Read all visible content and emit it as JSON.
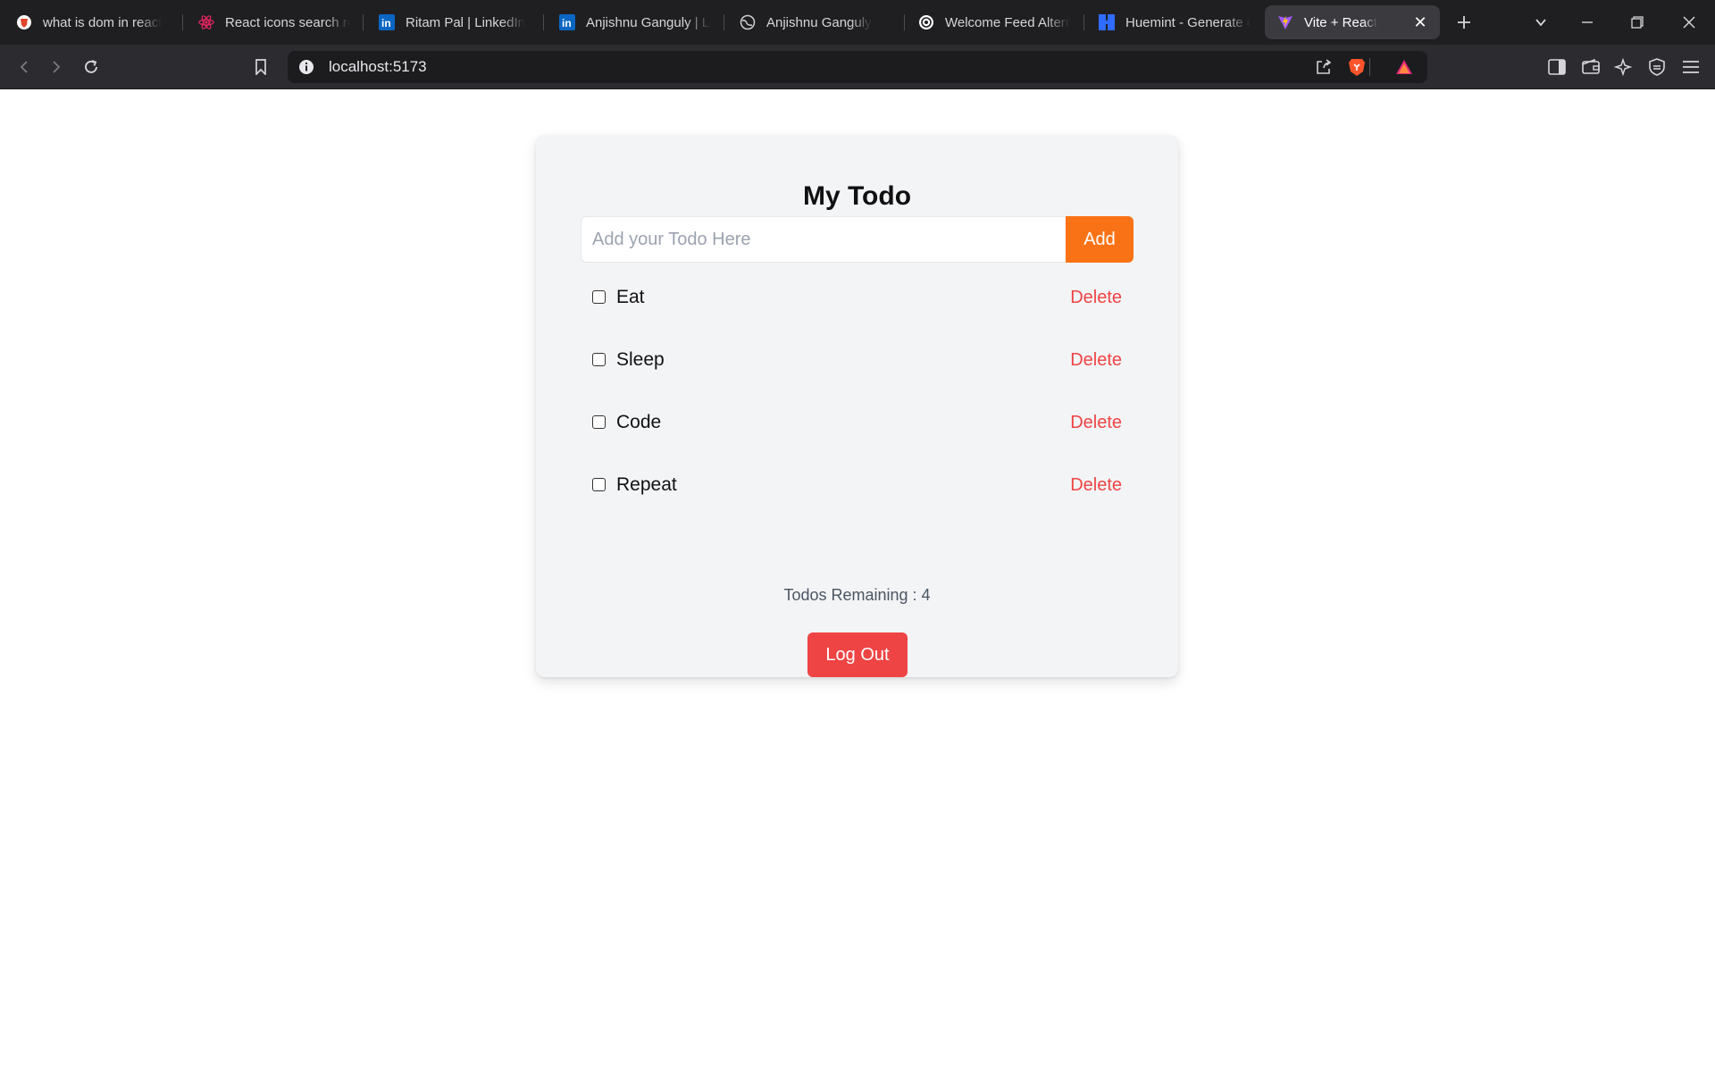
{
  "browser": {
    "tabs": [
      {
        "title": "what is dom in react",
        "icon": "brave-search-icon",
        "active": false
      },
      {
        "title": "React icons search re",
        "icon": "react-icon",
        "active": false
      },
      {
        "title": "Ritam Pal | LinkedIn",
        "icon": "linkedin-icon",
        "active": false
      },
      {
        "title": "Anjishnu Ganguly | Li",
        "icon": "linkedin-icon",
        "active": false
      },
      {
        "title": "Anjishnu Ganguly",
        "icon": "globe-icon",
        "active": false
      },
      {
        "title": "Welcome Feed Altern",
        "icon": "openai-icon",
        "active": false
      },
      {
        "title": "Huemint - Generate c",
        "icon": "huemint-icon",
        "active": false
      },
      {
        "title": "Vite + React",
        "icon": "vite-icon",
        "active": true
      }
    ],
    "url": "localhost:5173",
    "colors": {
      "tabbar": "#1f1f22",
      "toolbar": "#2b2b30",
      "urlbar": "#1c1c1f"
    }
  },
  "app": {
    "title": "My Todo",
    "input_placeholder": "Add your Todo Here",
    "add_label": "Add",
    "todos": [
      {
        "text": "Eat",
        "done": false,
        "delete_label": "Delete"
      },
      {
        "text": "Sleep",
        "done": false,
        "delete_label": "Delete"
      },
      {
        "text": "Code",
        "done": false,
        "delete_label": "Delete"
      },
      {
        "text": "Repeat",
        "done": false,
        "delete_label": "Delete"
      }
    ],
    "remaining_text": "Todos Remaining : 4",
    "logout_label": "Log Out",
    "colors": {
      "add": "#f97316",
      "delete": "#ef4444",
      "logout": "#ef4444",
      "card": "#f3f4f6"
    }
  }
}
